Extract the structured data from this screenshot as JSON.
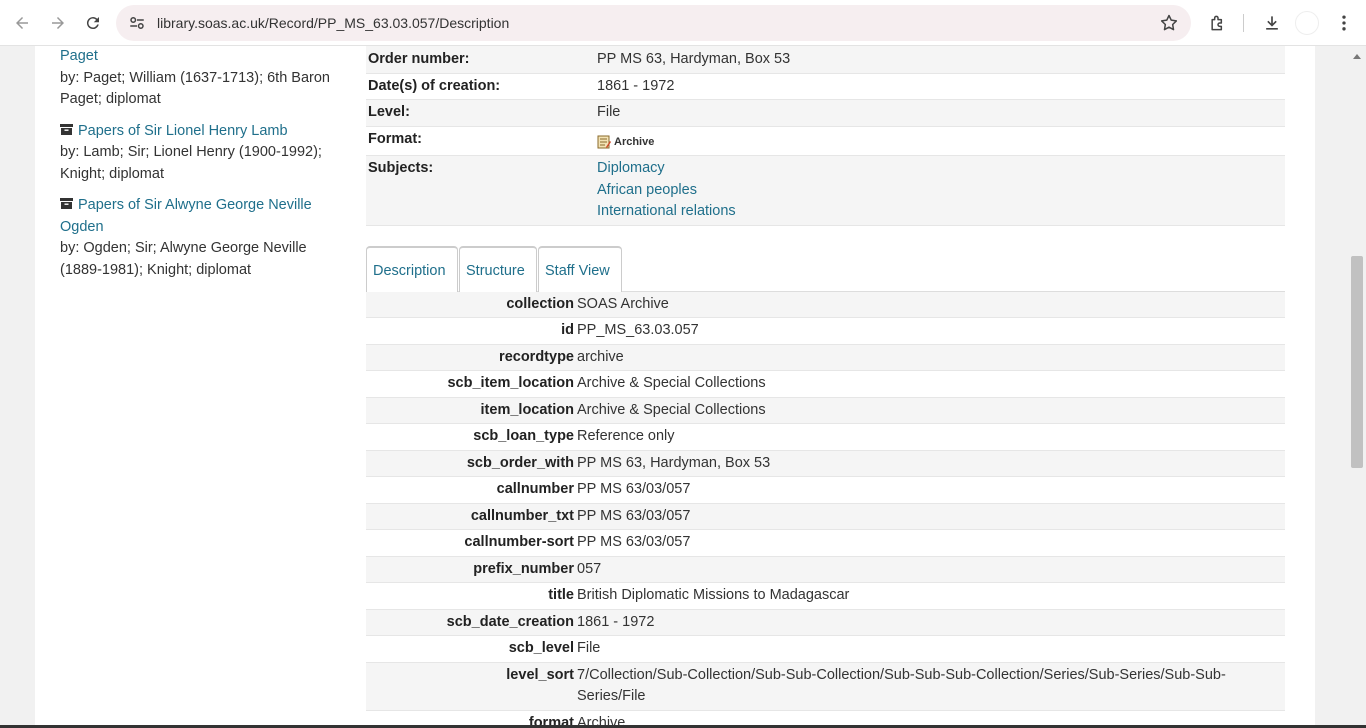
{
  "browser": {
    "url": "library.soas.ac.uk/Record/PP_MS_63.03.057/Description"
  },
  "sidebar": {
    "entries": [
      {
        "title": "Paget",
        "by": "by: Paget; William (1637-1713); 6th Baron Paget; diplomat",
        "has_icon": false
      },
      {
        "title": "Papers of Sir Lionel Henry Lamb",
        "by": "by: Lamb; Sir; Lionel Henry (1900-1992); Knight; diplomat",
        "has_icon": true
      },
      {
        "title": "Papers of Sir Alwyne George Neville Ogden",
        "by": "by: Ogden; Sir; Alwyne George Neville (1889-1981); Knight; diplomat",
        "has_icon": true
      }
    ]
  },
  "record": {
    "order_number_label": "Order number:",
    "order_number": "PP MS 63, Hardyman, Box 53",
    "dates_label": "Date(s) of creation:",
    "dates": "1861 - 1972",
    "level_label": "Level:",
    "level": "File",
    "format_label": "Format:",
    "format": "Archive",
    "subjects_label": "Subjects:",
    "subjects": [
      "Diplomacy",
      "African peoples",
      "International relations"
    ]
  },
  "tabs": [
    {
      "label": "Description"
    },
    {
      "label": "Structure"
    },
    {
      "label": "Staff View"
    }
  ],
  "staff_view": [
    {
      "key": "collection",
      "value": "SOAS Archive"
    },
    {
      "key": "id",
      "value": "PP_MS_63.03.057"
    },
    {
      "key": "recordtype",
      "value": "archive"
    },
    {
      "key": "scb_item_location",
      "value": "Archive & Special Collections"
    },
    {
      "key": "item_location",
      "value": "Archive & Special Collections"
    },
    {
      "key": "scb_loan_type",
      "value": "Reference only"
    },
    {
      "key": "scb_order_with",
      "value": "PP MS 63, Hardyman, Box 53"
    },
    {
      "key": "callnumber",
      "value": "PP MS 63/03/057"
    },
    {
      "key": "callnumber_txt",
      "value": "PP MS 63/03/057"
    },
    {
      "key": "callnumber-sort",
      "value": "PP MS 63/03/057"
    },
    {
      "key": "prefix_number",
      "value": "057"
    },
    {
      "key": "title",
      "value": "British Diplomatic Missions to Madagascar"
    },
    {
      "key": "scb_date_creation",
      "value": "1861 - 1972"
    },
    {
      "key": "scb_level",
      "value": "File"
    },
    {
      "key": "level_sort",
      "value": "7/Collection/Sub-Collection/Sub-Sub-Collection/Sub-Sub-Sub-Collection/Series/Sub-Series/Sub-Sub-Series/File"
    },
    {
      "key": "format",
      "value": "Archive"
    }
  ]
}
